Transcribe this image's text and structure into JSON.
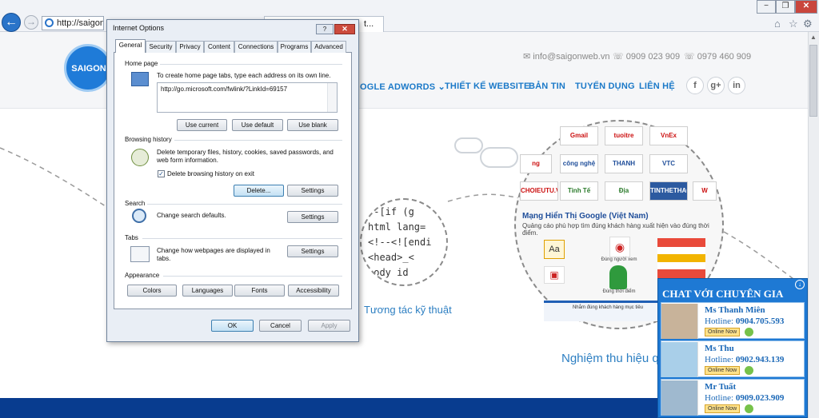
{
  "browser": {
    "back": "←",
    "address": "http://saigonwe",
    "tab2_fragment": "t...",
    "win_min": "−",
    "win_max": "❐",
    "win_close": "✕",
    "home": "⌂",
    "fav": "☆",
    "tools": "⚙"
  },
  "site": {
    "logo_text": "SAIGON",
    "email": "✉ info@saigonweb.vn",
    "phone1": "☏ 0909 023 909",
    "phone2": "☏ 0979 460 909",
    "nav": [
      "OGLE ADWORDS ⌄",
      "THIẾT KẾ WEBSITE",
      "BẢN TIN",
      "TUYỂN DỤNG",
      "LIÊN HỆ"
    ],
    "social": [
      "f",
      "g+",
      "in"
    ],
    "code_lines": [
      "--[if (g",
      "html lang=",
      "<!--<![endi",
      "<head>_<",
      "body id"
    ],
    "label1": "Tương tác kỹ thuật",
    "label2": "Nghiệm thu hiệu q",
    "tiles": [
      "Gmail",
      "tuoitre",
      "VnEx",
      "ng",
      "công nghệ",
      "THANH NIEN",
      "VTC",
      "CHOIEUTU.VN",
      "Tinh Tế",
      "Địa điểm.com",
      "TINTHETHAO",
      "W"
    ],
    "ad_title": "Mạng Hiển Thị Google (Việt Nam)",
    "ad_sub": "Quảng cáo phù hợp tìm đúng khách hàng xuất hiện vào đúng thời điểm.",
    "ad_small1": "Đúng người xem",
    "ad_small2": "Đúng thời điểm",
    "ad_small3": "Nhắm đúng khách hàng mục tiêu"
  },
  "chat": {
    "title": "CHAT VỚI CHUYÊN GIA",
    "agents": [
      {
        "name": "Ms Thanh Miên",
        "hotline_label": "Hotline:",
        "phone": "0904.705.593",
        "status": "Online Now"
      },
      {
        "name": "Ms Thu",
        "hotline_label": "Hotline:",
        "phone": "0902.943.139",
        "status": "Online Now"
      },
      {
        "name": "Mr Tuất",
        "hotline_label": "Hotline:",
        "phone": "0909.023.909",
        "status": "Online Now"
      }
    ]
  },
  "dialog": {
    "title": "Internet Options",
    "help": "?",
    "close": "✕",
    "tabs": [
      "General",
      "Security",
      "Privacy",
      "Content",
      "Connections",
      "Programs",
      "Advanced"
    ],
    "home_section": "Home page",
    "home_desc": "To create home page tabs, type each address on its own line.",
    "home_url": "http://go.microsoft.com/fwlink/?LinkId=69157",
    "use_current": "Use current",
    "use_default": "Use default",
    "use_blank": "Use blank",
    "history_section": "Browsing history",
    "history_desc": "Delete temporary files, history, cookies, saved passwords, and web form information.",
    "delete_on_exit": "Delete browsing history on exit",
    "delete_btn": "Delete...",
    "settings": "Settings",
    "search_section": "Search",
    "search_desc": "Change search defaults.",
    "tabs_section": "Tabs",
    "tabs_desc": "Change how webpages are displayed in tabs.",
    "appearance_section": "Appearance",
    "colors": "Colors",
    "languages": "Languages",
    "fonts": "Fonts",
    "accessibility": "Accessibility",
    "ok": "OK",
    "cancel": "Cancel",
    "apply": "Apply"
  }
}
